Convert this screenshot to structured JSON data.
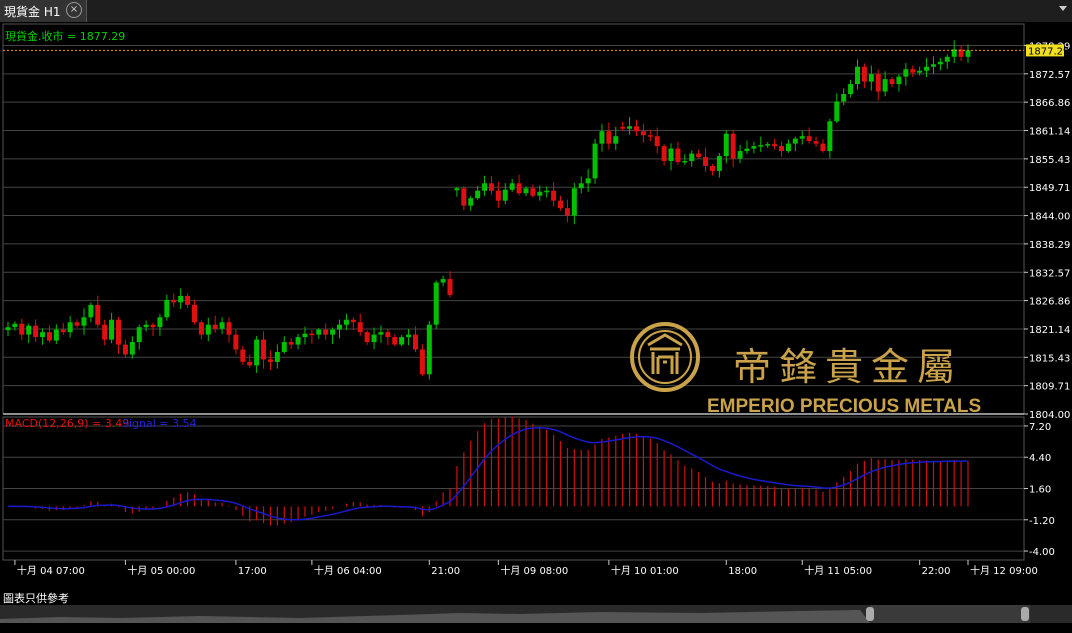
{
  "window": {
    "tab_title": "現貨金 H1",
    "close_icon": "close-icon",
    "menu_icon": "caret-down-icon"
  },
  "chart_data": [
    {
      "type": "candlestick",
      "title": "現貨金.收市 = 1877.29",
      "current_price": "1877.29",
      "ylim": [
        1804.0,
        1881.0
      ],
      "yticks": [
        "1878.29",
        "1872.57",
        "1866.86",
        "1861.14",
        "1855.43",
        "1849.71",
        "1844.00",
        "1838.29",
        "1832.57",
        "1826.86",
        "1821.14",
        "1815.43",
        "1809.71",
        "1804.00"
      ],
      "xticks": [
        {
          "label": "十月 04 07:00",
          "x": 1
        },
        {
          "label": "十月 05 00:00",
          "x": 17
        },
        {
          "label": "17:00",
          "x": 33
        },
        {
          "label": "十月 06 04:00",
          "x": 44
        },
        {
          "label": "21:00",
          "x": 61
        },
        {
          "label": "十月 09 08:00",
          "x": 71
        },
        {
          "label": "十月 10 01:00",
          "x": 87
        },
        {
          "label": "18:00",
          "x": 104
        },
        {
          "label": "十月 11 05:00",
          "x": 115
        },
        {
          "label": "22:00",
          "x": 132
        },
        {
          "label": "十月 12 09:00",
          "x": 143
        }
      ],
      "up_color": "#00c000",
      "down_color": "#e01010",
      "gaps_after": [
        64,
        88
      ],
      "candles_close": [
        1821.5,
        1822.2,
        1820.0,
        1821.8,
        1819.5,
        1820.5,
        1818.8,
        1821.0,
        1820.5,
        1822.5,
        1821.8,
        1823.5,
        1826.0,
        1822.0,
        1819.0,
        1823.0,
        1818.0,
        1816.0,
        1818.5,
        1821.5,
        1822.0,
        1821.5,
        1823.5,
        1827.0,
        1826.5,
        1827.8,
        1826.0,
        1822.5,
        1820.0,
        1822.0,
        1821.2,
        1822.5,
        1820.0,
        1817.0,
        1814.5,
        1813.8,
        1819.0,
        1815.0,
        1814.5,
        1816.5,
        1818.5,
        1818.0,
        1819.5,
        1820.2,
        1820.0,
        1821.0,
        1820.0,
        1821.0,
        1822.0,
        1823.0,
        1822.5,
        1820.5,
        1818.5,
        1820.0,
        1820.5,
        1819.5,
        1818.0,
        1819.5,
        1820.0,
        1817.0,
        1812.0,
        1822.0,
        1830.5,
        1831.2,
        1828.0,
        1849.5,
        1846.0,
        1847.5,
        1849.0,
        1850.5,
        1849.0,
        1847.0,
        1849.2,
        1850.5,
        1848.5,
        1849.5,
        1848.0,
        1848.8,
        1849.0,
        1847.0,
        1845.5,
        1844.0,
        1849.5,
        1850.5,
        1851.5,
        1858.5,
        1861.0,
        1858.5,
        1860.0,
        1861.5,
        1862.0,
        1861.0,
        1860.2,
        1860.0,
        1858.0,
        1855.0,
        1857.5,
        1854.8,
        1855.0,
        1856.5,
        1855.8,
        1854.0,
        1853.0,
        1856.0,
        1860.5,
        1855.5,
        1857.0,
        1857.5,
        1858.0,
        1858.2,
        1858.4,
        1858.0,
        1857.0,
        1858.5,
        1859.5,
        1860.0,
        1859.0,
        1858.5,
        1857.0,
        1863.0,
        1867.0,
        1868.5,
        1870.5,
        1874.0,
        1871.0,
        1872.5,
        1869.0,
        1871.5,
        1870.5,
        1872.0,
        1873.5,
        1872.8,
        1873.2,
        1874.0,
        1874.5,
        1875.0,
        1876.0,
        1877.5,
        1876.0,
        1877.29
      ],
      "macd_label": "MACD(12,26,9) = 3.49",
      "signal_label": "Signal = 3.54",
      "macd_ylim": [
        -4.8,
        8.0
      ],
      "macd_yticks": [
        "7.20",
        "4.40",
        "1.60",
        "-1.20",
        "-4.00"
      ],
      "macd_hist_color": "#d01010",
      "signal_color": "#1a1acc"
    }
  ],
  "watermark": {
    "company_cn": "帝鋒貴金屬",
    "company_en": "EMPERIO PRECIOUS METALS"
  },
  "footer": {
    "note": "圖表只供參考"
  }
}
